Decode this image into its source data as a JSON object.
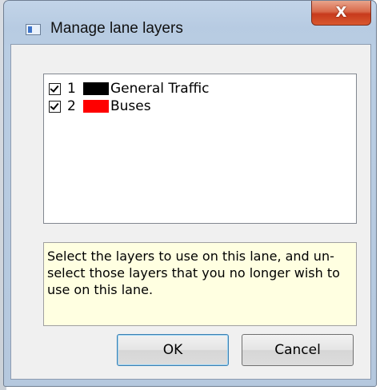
{
  "window": {
    "title": "Manage lane layers",
    "close_label": "X"
  },
  "layers": [
    {
      "checked": true,
      "number": "1",
      "color": "#000000",
      "name": "General Traffic"
    },
    {
      "checked": true,
      "number": "2",
      "color": "#ff0000",
      "name": "Buses"
    }
  ],
  "hint": "Select the layers to use on this lane, and un-select those layers that you no longer wish to use on this lane.",
  "buttons": {
    "ok": "OK",
    "cancel": "Cancel"
  }
}
